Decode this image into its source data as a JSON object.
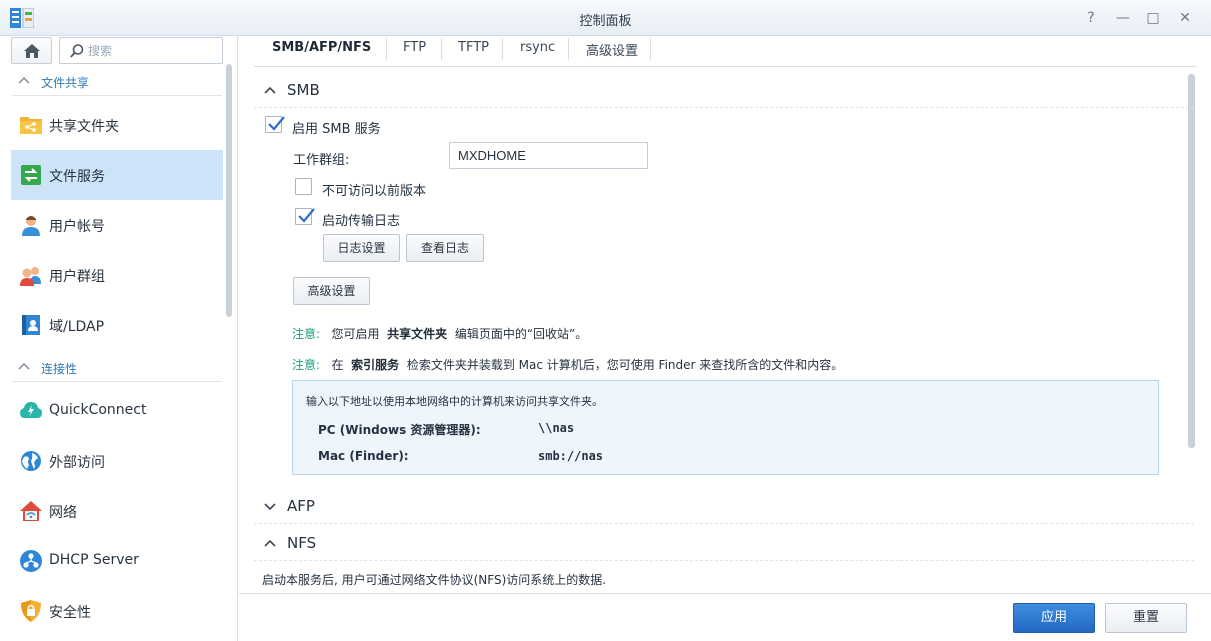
{
  "window": {
    "title": "控制面板",
    "controls": [
      "?",
      "—",
      "□",
      "✕"
    ]
  },
  "sidebar": {
    "search_placeholder": "搜索",
    "sections": [
      {
        "label": "文件共享"
      },
      {
        "label": "连接性"
      }
    ],
    "items": [
      {
        "label": "共享文件夹",
        "icon": "shared-folder-icon"
      },
      {
        "label": "文件服务",
        "icon": "file-services-icon",
        "active": true
      },
      {
        "label": "用户帐号",
        "icon": "user-icon"
      },
      {
        "label": "用户群组",
        "icon": "group-icon"
      },
      {
        "label": "域/LDAP",
        "icon": "domain-ldap-icon"
      },
      {
        "label": "QuickConnect",
        "icon": "quickconnect-icon"
      },
      {
        "label": "外部访问",
        "icon": "external-access-icon"
      },
      {
        "label": "网络",
        "icon": "network-icon"
      },
      {
        "label": "DHCP Server",
        "icon": "dhcp-server-icon"
      },
      {
        "label": "安全性",
        "icon": "security-icon"
      }
    ]
  },
  "tabs": [
    "SMB/AFP/NFS",
    "FTP",
    "TFTP",
    "rsync",
    "高级设置"
  ],
  "smb": {
    "title": "SMB",
    "enable_label": "启用 SMB 服务",
    "enable_checked": true,
    "workgroup_label": "工作群组:",
    "workgroup_value": "MXDHOME",
    "prev_versions_label": "不可访问以前版本",
    "prev_versions_checked": false,
    "transfer_log_label": "启动传输日志",
    "transfer_log_checked": true,
    "log_settings_button": "日志设置",
    "view_log_button": "查看日志",
    "advanced_button": "高级设置",
    "note1": {
      "prefix": "注意:",
      "text_a": "您可启用",
      "bold": "共享文件夹",
      "text_b": "编辑页面中的“回收站”。"
    },
    "note2": {
      "prefix": "注意:",
      "text_a": "在",
      "bold": "索引服务",
      "text_b": "检索文件夹并装载到 Mac 计算机后，您可使用 Finder 来查找所含的文件和内容。"
    },
    "info": {
      "intro": "输入以下地址以使用本地网络中的计算机来访问共享文件夹。",
      "rows": [
        {
          "key": "PC (Windows 资源管理器):",
          "value": "\\\\nas"
        },
        {
          "key": "Mac (Finder):",
          "value": "smb://nas"
        }
      ]
    }
  },
  "afp": {
    "title": "AFP"
  },
  "nfs": {
    "title": "NFS",
    "desc": "启动本服务后, 用户可通过网络文件协议(NFS)访问系统上的数据."
  },
  "footer": {
    "apply": "应用",
    "reset": "重置"
  },
  "colors": {
    "accent": "#2e79b8",
    "active_nav": "#cde3f7",
    "primary_button": "#2a6fcc",
    "note_green": "#1e9c7a",
    "info_bg": "#eef6fc"
  }
}
